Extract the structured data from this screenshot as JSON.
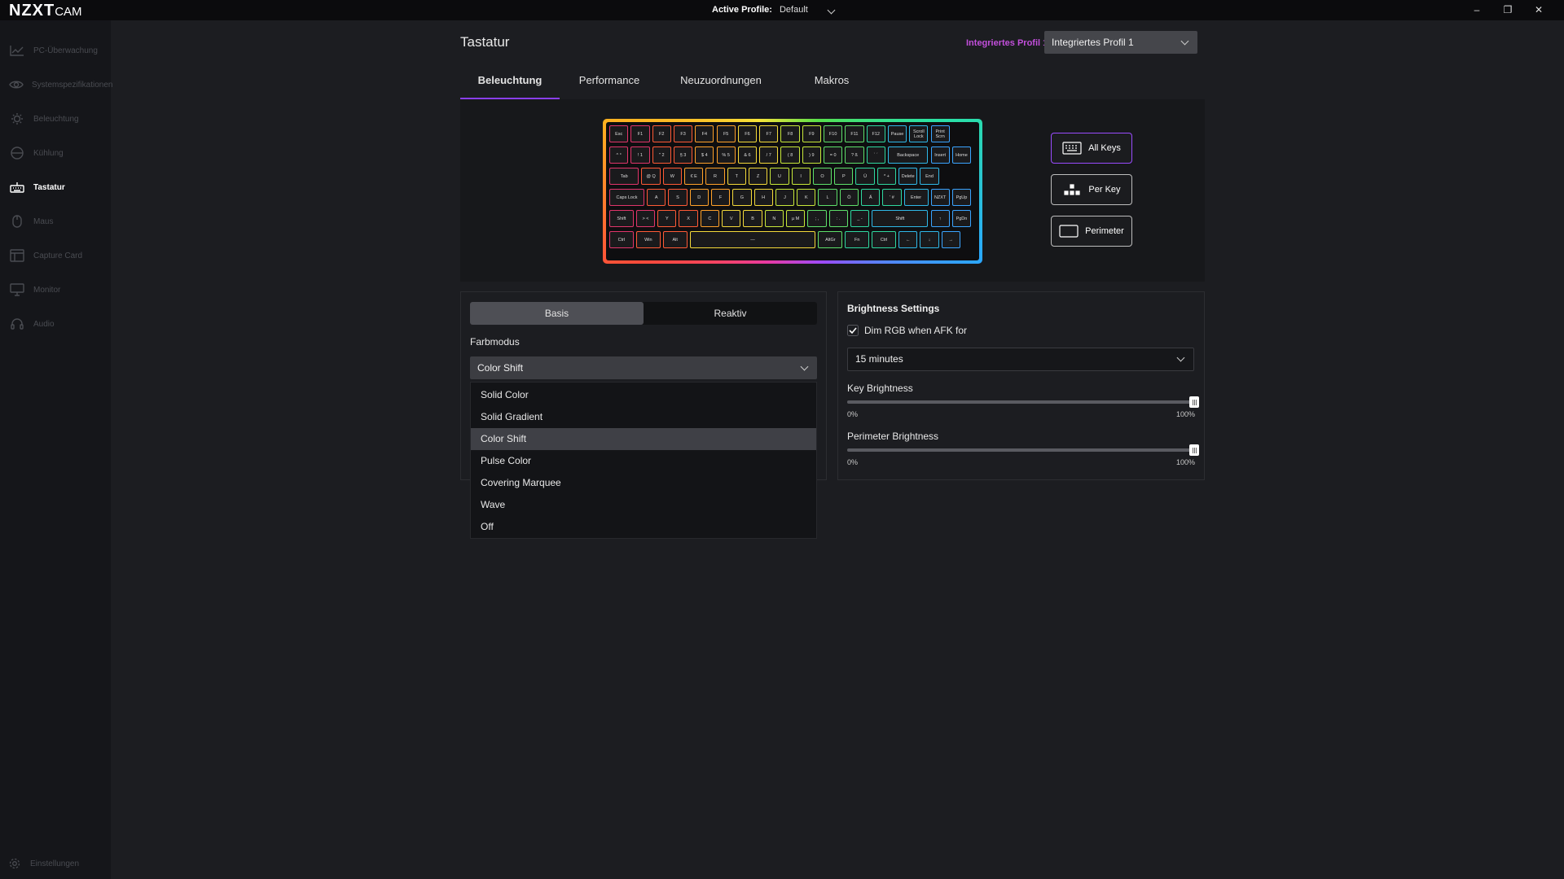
{
  "app": {
    "logo_main": "NZXT",
    "logo_sub": "CAM"
  },
  "titlebar": {
    "active_profile_label": "Active Profile:",
    "active_profile_value": "Default",
    "minimize": "–",
    "maximize": "❐",
    "close": "✕"
  },
  "sidebar": {
    "items": [
      {
        "label": "PC-Überwachung",
        "icon": "chart-line-icon"
      },
      {
        "label": "Systemspezifikationen",
        "icon": "eye-icon"
      },
      {
        "label": "Beleuchtung",
        "icon": "sun-icon"
      },
      {
        "label": "Kühlung",
        "icon": "fan-icon"
      },
      {
        "label": "Tastatur",
        "icon": "keyboard-icon",
        "active": true
      },
      {
        "label": "Maus",
        "icon": "mouse-icon"
      },
      {
        "label": "Capture Card",
        "icon": "capture-card-icon"
      },
      {
        "label": "Monitor",
        "icon": "monitor-icon"
      },
      {
        "label": "Audio",
        "icon": "headset-icon"
      }
    ],
    "settings_label": "Einstellungen"
  },
  "header": {
    "title": "Tastatur",
    "profile_label": "Integriertes Profil 1",
    "profile_select": "Integriertes Profil 1"
  },
  "tabs": [
    "Beleuchtung",
    "Performance",
    "Neuzuordnungen",
    "Makros"
  ],
  "keyboard": {
    "rows": [
      [
        "Esc",
        "F1",
        "F2",
        "F3",
        "F4",
        "F5",
        "F6",
        "F7",
        "F8",
        "F9",
        "F10",
        "F11",
        "F12",
        "Pause",
        "Scroll Lock",
        "Print Scrn"
      ],
      [
        "^ °",
        "! 1",
        "\" 2",
        "§ 3",
        "$ 4",
        "% 5",
        "& 6",
        "/ 7",
        "( 8",
        ") 9",
        "= 0",
        "? ß",
        "` ´",
        "Backspace",
        "Insert",
        "Home"
      ],
      [
        "Tab",
        "@ Q",
        "W",
        "€ E",
        "R",
        "T",
        "Z",
        "U",
        "I",
        "O",
        "P",
        "Ü",
        "* +",
        "Delete",
        "End"
      ],
      [
        "Caps Lock",
        "A",
        "S",
        "D",
        "F",
        "G",
        "H",
        "J",
        "K",
        "L",
        "Ö",
        "Ä",
        "' #",
        "Enter",
        "NZXT",
        "PgUp"
      ],
      [
        "Shift",
        "> <",
        "Y",
        "X",
        "C",
        "V",
        "B",
        "N",
        "µ M",
        "; ,",
        ": .",
        "_ -",
        "Shift",
        "↑",
        "PgDn"
      ],
      [
        "Ctrl",
        "Win",
        "Alt",
        "—",
        "AltGr",
        "Fn",
        "Ctrl",
        "←",
        "↓",
        "→"
      ]
    ]
  },
  "modes": [
    {
      "label": "All Keys",
      "icon": "keyboard-icon",
      "active": true
    },
    {
      "label": "Per Key",
      "icon": "dots-icon"
    },
    {
      "label": "Perimeter",
      "icon": "perimeter-icon"
    }
  ],
  "lighting": {
    "segments": [
      "Basis",
      "Reaktiv"
    ],
    "color_mode_label": "Farbmodus",
    "color_mode_value": "Color Shift",
    "options": [
      "Solid Color",
      "Solid Gradient",
      "Color Shift",
      "Pulse Color",
      "Covering Marquee",
      "Wave",
      "Off"
    ],
    "selected_option_index": 2
  },
  "brightness": {
    "title": "Brightness Settings",
    "dim_label": "Dim RGB when AFK for",
    "dim_checked": true,
    "afk_value": "15 minutes",
    "key_label": "Key Brightness",
    "key_value": 1.0,
    "perimeter_label": "Perimeter Brightness",
    "perimeter_value": 1.0,
    "min_label": "0%",
    "max_label": "100%"
  },
  "colors": {
    "accent": "#8a3ff0",
    "profile_label": "#c24fdb",
    "background": "#1c1d21",
    "sidebar": "#15161a"
  }
}
